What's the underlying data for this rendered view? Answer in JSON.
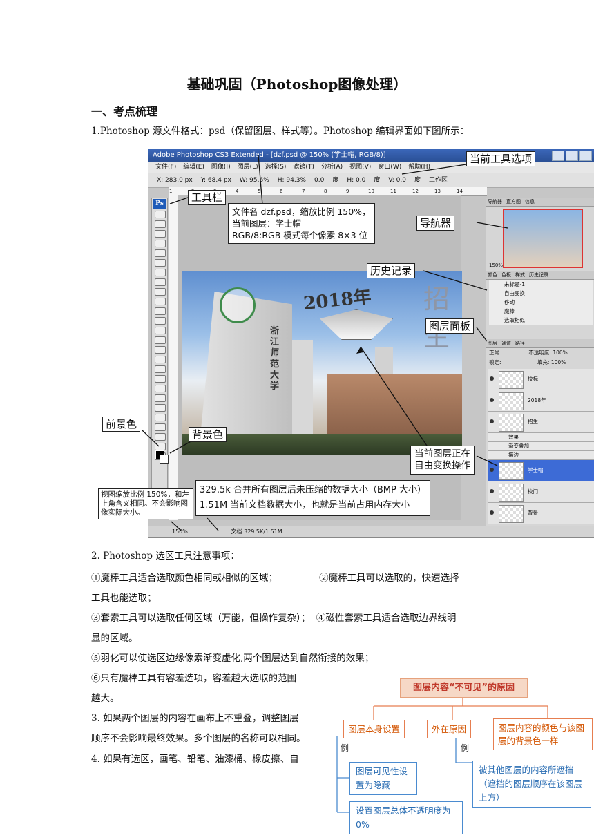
{
  "doc": {
    "title": "基础巩固（Photoshop图像处理）",
    "section1": "一、考点梳理",
    "item1": "1.Photoshop 源文件格式：psd（保留图层、样式等）。Photoshop 编辑界面如下图所示：",
    "item2_title": "2. Photoshop 选区工具注意事项：",
    "item2_lines": [
      "①魔棒工具适合选取颜色相同或相似的区域；              ②魔棒工具可以选取的，快速选择",
      "工具也能选取；",
      "③套索工具可以选取任何区域（万能，但操作复杂）；  ④磁性套索工具适合选取边界线明",
      "显的区域。",
      "⑤羽化可以使选区边缘像素渐变虚化,两个图层达到自然衔接的效果；",
      "⑥只有魔棒工具有容差选项，容差越大选取的范围",
      "越大。"
    ],
    "item3_lines": [
      "3. 如果两个图层的内容在画布上不重叠，调整图层",
      "顺序不会影响最终效果。多个图层的名称可以相同。"
    ],
    "item4_line": "4. 如果有选区，画笔、铅笔、油漆桶、橡皮擦、自"
  },
  "screenshot": {
    "title_bar": "Adobe Photoshop CS3 Extended - [dzf.psd @ 150% (学士帽, RGB/8)]",
    "menu": [
      "文件(F)",
      "编辑(E)",
      "图像(I)",
      "图层(L)",
      "选择(S)",
      "滤镜(T)",
      "分析(A)",
      "视图(V)",
      "窗口(W)",
      "帮助(H)"
    ],
    "options": [
      "X: 283.0 px",
      "Y: 68.4 px",
      "W: 95.6%",
      "H: 94.3%",
      "0.0",
      "度",
      "H: 0.0",
      "度",
      "V: 0.0",
      "度",
      "工作区"
    ],
    "ruler_marks": [
      "1",
      "2",
      "3",
      "4",
      "5",
      "6",
      "7",
      "8",
      "9",
      "10",
      "11",
      "12",
      "13",
      "14"
    ],
    "photo_text": {
      "year": "2018年",
      "zhaosheng": "招生",
      "school": "浙江师范大学"
    },
    "nav_tabs": [
      "导航器",
      "直方图",
      "信息"
    ],
    "nav_zoom": "150%",
    "hist_tabs": [
      "颜色",
      "色板",
      "样式",
      "历史记录"
    ],
    "history_items": [
      "未标题-1",
      "自由变换",
      "移动",
      "魔棒",
      "选取相似"
    ],
    "layer_tabs": [
      "图层",
      "通道",
      "路径"
    ],
    "blend_mode": "正常",
    "opacity_label": "不透明度:",
    "opacity_value": "100%",
    "lock_label": "锁定:",
    "fill_label": "填充:",
    "fill_value": "100%",
    "layers": [
      "校标",
      "2018年",
      "招生",
      "学士帽",
      "校门",
      "背景"
    ],
    "effects": [
      "效果",
      "渐变叠加",
      "描边"
    ],
    "status_zoom": "150%",
    "status_doc": "文档:329.5K/1.51M"
  },
  "callouts": {
    "current_tool_options": "当前工具选项",
    "toolbar": "工具栏",
    "file_info": [
      "文件名 dzf.psd，缩放比例 150%，",
      "当前图层：学士帽",
      "RGB/8:RGB 模式每个像素 8×3 位"
    ],
    "navigator": "导航器",
    "history": "历史记录",
    "layers_panel": "图层面板",
    "foreground": "前景色",
    "background": "背景色",
    "current_layer": [
      "当前图层正在",
      "自由变换操作"
    ],
    "zoom_note": "视图缩放比例 150%，和左上角含义相同。不会影响图像实际大小。",
    "doc_size": [
      "329.5k 合并所有图层后未压缩的数据大小（BMP 大小）",
      "1.51M 当前文档数据大小，也就是当前占用内存大小"
    ]
  },
  "mindmap": {
    "root": "图层内容“不可见”的原因",
    "branches": [
      "图层本身设置",
      "外在原因",
      "图层内容的颜色与该图层的背景色一样"
    ],
    "example_label": "例",
    "leaf1": "图层可见性设置为隐藏",
    "leaf2": "设置图层总体不透明度为0%",
    "leaf3": "被其他图层的内容所遮挡（遮挡的图层顺序在该图层上方）"
  }
}
